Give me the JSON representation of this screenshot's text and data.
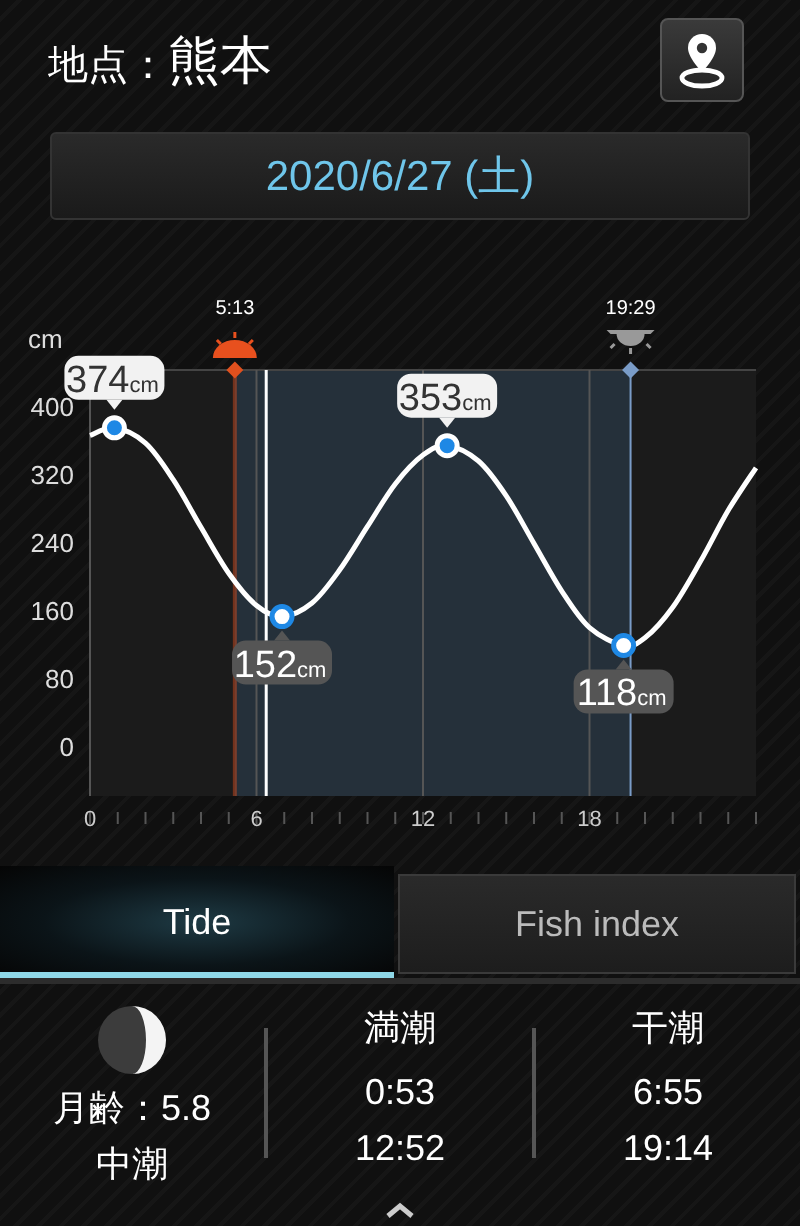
{
  "location": {
    "label": "地点：",
    "name": "熊本"
  },
  "date": "2020/6/27 (土)",
  "chart_data": {
    "type": "line",
    "ylabel": "cm",
    "grid": true,
    "x": [
      0,
      0.88,
      2,
      3,
      4,
      5,
      6,
      6.92,
      8,
      9,
      10,
      11,
      12,
      12.87,
      14,
      15,
      16,
      17,
      18,
      19.23,
      20,
      21,
      22,
      23,
      24
    ],
    "series": [
      {
        "color": "#ffffff",
        "values": [
          365,
          374,
          356,
          313,
          257,
          203,
          165,
          152,
          168,
          207,
          258,
          308,
          342,
          353,
          335,
          294,
          238,
          182,
          139,
          118,
          127,
          163,
          217,
          277,
          327
        ]
      }
    ],
    "xlim": [
      0,
      24
    ],
    "ylim": [
      -59,
      442
    ],
    "xticks": [
      0,
      6,
      12,
      18
    ],
    "yticks": [
      0,
      80,
      160,
      240,
      320,
      400
    ],
    "annotations": [
      {
        "x": 0.88,
        "y": 374,
        "text": "374cm"
      },
      {
        "x": 6.92,
        "y": 152,
        "text": "152cm"
      },
      {
        "x": 12.87,
        "y": 353,
        "text": "353cm"
      },
      {
        "x": 19.23,
        "y": 118,
        "text": "118cm"
      }
    ],
    "bands": [
      {
        "axis": "x",
        "from": 5.22,
        "to": 19.48,
        "color": "#25303a"
      }
    ],
    "ref_lines": [
      {
        "axis": "x",
        "value": 5.22,
        "label": "5:13",
        "color": "#e0501e"
      },
      {
        "axis": "x",
        "value": 6.35,
        "color": "#ffffff"
      },
      {
        "axis": "x",
        "value": 19.48,
        "label": "19:29",
        "color": "#7a9cc8"
      }
    ]
  },
  "tabs": [
    {
      "label": "Tide",
      "selected": true
    },
    {
      "label": "Fish index",
      "selected": false
    }
  ],
  "moon": {
    "age": "月齢：5.8",
    "tide_name": "中潮"
  },
  "tide_columns": [
    {
      "title": "満潮",
      "times": [
        "0:53",
        "12:52"
      ]
    },
    {
      "title": "干潮",
      "times": [
        "6:55",
        "19:14"
      ]
    }
  ]
}
